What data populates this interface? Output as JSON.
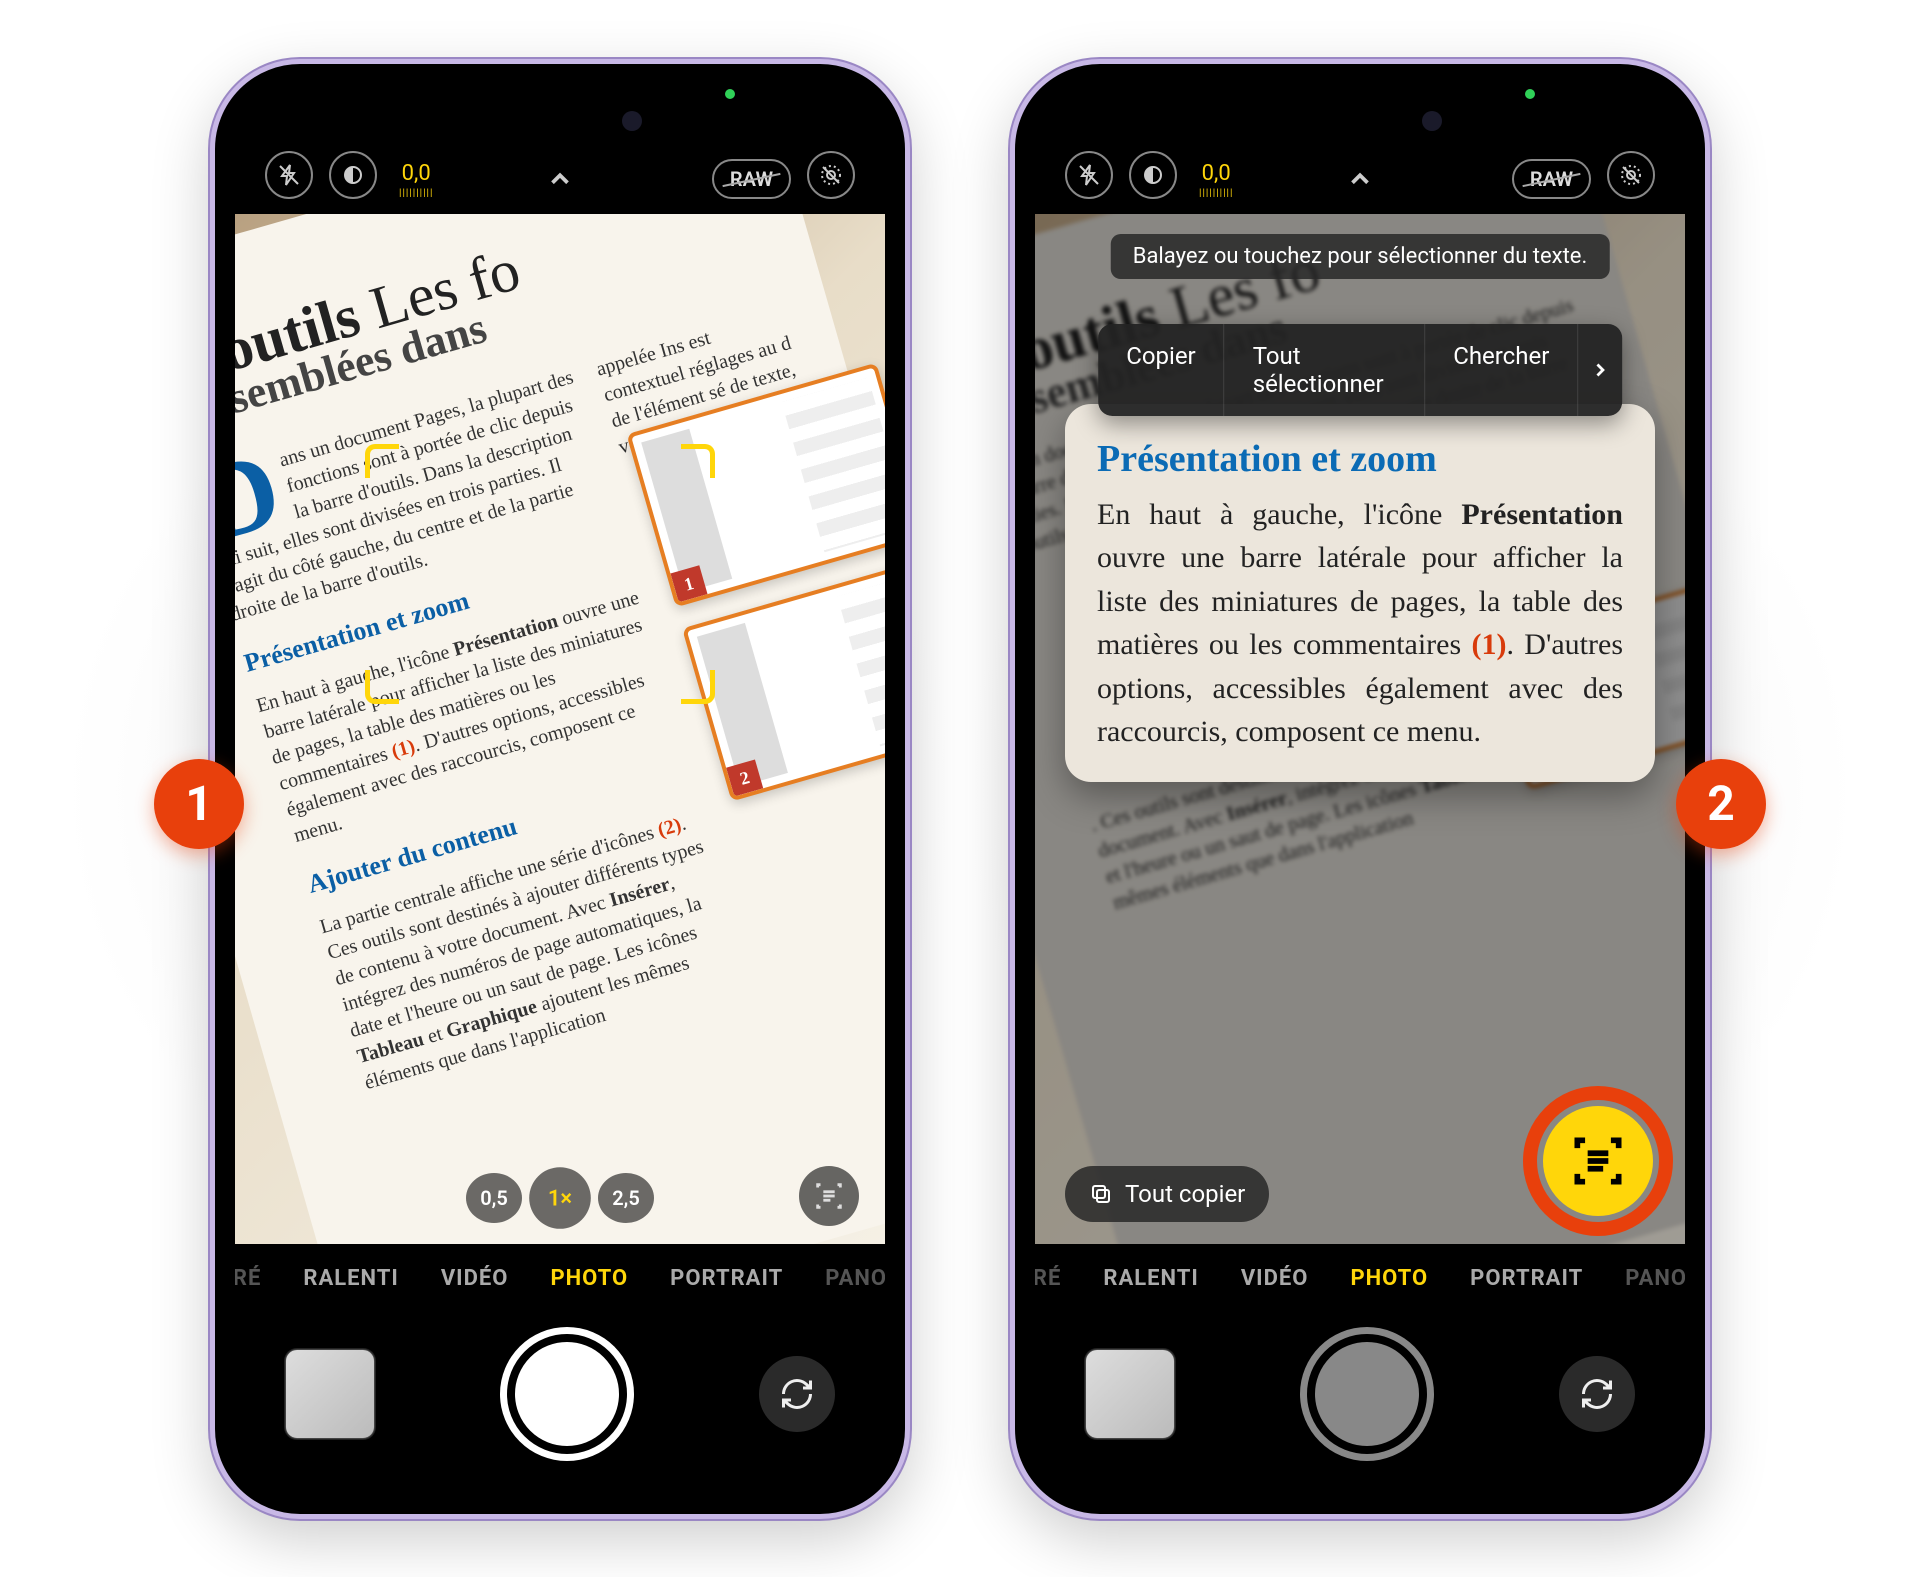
{
  "step_badges": {
    "one": "1",
    "two": "2"
  },
  "topbar": {
    "exposure_value": "0,0",
    "raw_label": "RAW"
  },
  "zoom": {
    "wide": "0,5",
    "one": "1×",
    "tele": "2,5"
  },
  "modes": {
    "cinematic_fragment": "RÉ",
    "slomo": "RALENTI",
    "video": "VIDÉO",
    "photo": "PHOTO",
    "portrait": "PORTRAIT",
    "pano": "PANO"
  },
  "page_text": {
    "title1": "es outils",
    "title2": "Les fo",
    "subtitle": "rassemblées dans",
    "intro": "ans un document Pages, la plupart des fonctions sont à portée de clic depuis la barre d'outils. Dans la description qui suit, elles sont divisées en trois parties. Il s'agit du côté gauche, du centre et de la partie droite de la barre d'outils.",
    "intro_right": "appelée Ins est contextuel réglages au d de l'élément sé de texte, vous t cifications de ta",
    "h1": "Présentation et zoom",
    "p1a": "En haut à gauche, l'icône",
    "p1_bold": "Présentation",
    "p1b": "ouvre une barre latérale pour afficher la liste des miniatures de pages, la table des matières ou les commentaires",
    "p1_marker": "(1)",
    "p1c": ". D'autres options, accessibles également avec des raccourcis, composent ce menu.",
    "h2": "Ajouter du contenu",
    "p2a": "La partie centrale affiche une série d'icônes",
    "p2_marker": "(2)",
    "p2b": ". Ces outils sont destinés à ajouter différents types de contenu à votre document. Avec",
    "p2_bold": "Insérer",
    "p2c": ", intégrez des numéros de page automatiques, la date et l'heure ou un saut de page. Les icônes",
    "p2_bold2": "Tableau",
    "p2d": "et",
    "p2_bold3": "Graphique",
    "p2e": "ajoutent les mêmes éléments que dans l'application"
  },
  "phone2": {
    "tooltip": "Balayez ou touchez pour sélectionner du texte.",
    "menu": {
      "copy": "Copier",
      "select_all": "Tout sélectionner",
      "search": "Chercher"
    },
    "copy_all": "Tout copier",
    "card": {
      "heading": "Présentation et zoom",
      "line1a": "En haut à gauche, l'icône ",
      "line1b": "Présentation",
      "line2": " ouvre une barre latérale pour afficher la liste des miniatures de pages, la table des matières ou les commentaires ",
      "marker": "(1)",
      "line3": ". D'autres options, accessibles également avec des raccourcis, composent ce menu."
    }
  }
}
